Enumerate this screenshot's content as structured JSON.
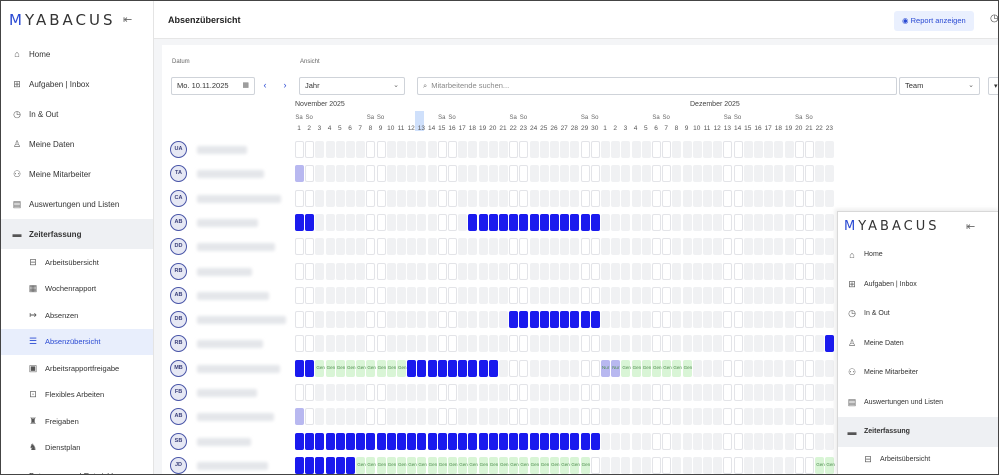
{
  "app": {
    "logo": "MYABACUS",
    "page_title": "Absenzübersicht",
    "report_button": "Report anzeigen"
  },
  "sidebar": {
    "items": [
      {
        "label": "Home",
        "icon": "home-icon",
        "type": "item"
      },
      {
        "label": "Aufgaben | Inbox",
        "icon": "inbox-icon",
        "type": "item"
      },
      {
        "label": "In & Out",
        "icon": "clock-icon",
        "type": "item"
      },
      {
        "label": "Meine Daten",
        "icon": "person-icon",
        "type": "item"
      },
      {
        "label": "Meine Mitarbeiter",
        "icon": "team-icon",
        "type": "item"
      },
      {
        "label": "Auswertungen und Listen",
        "icon": "document-icon",
        "type": "item"
      },
      {
        "label": "Zeiterfassung",
        "icon": "folder-icon",
        "type": "head"
      },
      {
        "label": "Arbeitsübersicht",
        "icon": "grid-icon",
        "type": "sub"
      },
      {
        "label": "Wochenrapport",
        "icon": "calendar-icon",
        "type": "sub"
      },
      {
        "label": "Absenzen",
        "icon": "exit-icon",
        "type": "sub"
      },
      {
        "label": "Absenzübersicht",
        "icon": "list-icon",
        "type": "sub",
        "active": true
      },
      {
        "label": "Arbeitsrapportfreigabe",
        "icon": "calendar-check-icon",
        "type": "sub"
      },
      {
        "label": "Flexibles Arbeiten",
        "icon": "desk-icon",
        "type": "sub"
      },
      {
        "label": "Freigaben",
        "icon": "approval-icon",
        "type": "sub"
      },
      {
        "label": "Dienstplan",
        "icon": "shift-icon",
        "type": "sub"
      },
      {
        "label": "Betreuung und Entwicklung",
        "icon": "folder-icon",
        "type": "item"
      }
    ]
  },
  "overlay_sidebar": {
    "items": [
      {
        "label": "Home",
        "icon": "home-icon",
        "type": "item"
      },
      {
        "label": "Aufgaben | Inbox",
        "icon": "inbox-icon",
        "type": "item"
      },
      {
        "label": "In & Out",
        "icon": "clock-icon",
        "type": "item"
      },
      {
        "label": "Meine Daten",
        "icon": "person-icon",
        "type": "item"
      },
      {
        "label": "Meine Mitarbeiter",
        "icon": "team-icon",
        "type": "item"
      },
      {
        "label": "Auswertungen und Listen",
        "icon": "document-icon",
        "type": "item"
      },
      {
        "label": "Zeiterfassung",
        "icon": "folder-icon",
        "type": "head"
      },
      {
        "label": "Arbeitsübersicht",
        "icon": "grid-icon",
        "type": "sub"
      }
    ]
  },
  "filters": {
    "date_label": "Datum",
    "date_value": "Mo. 10.11.2025",
    "view_label": "Ansicht",
    "view_value": "Jahr",
    "search_placeholder": "Mitarbeitende suchen...",
    "team_value": "Team"
  },
  "timeline": {
    "months": [
      "November 2025",
      "Dezember 2025"
    ],
    "days": [
      1,
      2,
      3,
      4,
      5,
      6,
      7,
      8,
      9,
      10,
      11,
      12,
      13,
      14,
      15,
      16,
      17,
      18,
      19,
      20,
      21,
      22,
      23,
      24,
      25,
      26,
      27,
      28,
      29,
      30,
      1,
      2,
      3,
      4,
      5,
      6,
      7,
      8,
      9,
      10,
      11,
      12,
      13,
      14,
      15,
      16,
      17,
      18,
      19,
      20,
      21,
      22,
      23
    ],
    "weekend_labels": [
      "Sa",
      "So"
    ],
    "today_day": "10. November"
  },
  "colors": {
    "absence": "#1a1aee",
    "half_absence": "#b8b8f0",
    "flex": "#d9f5d6",
    "cell": "#f0f1f3",
    "brand": "#2a4ad3"
  },
  "employees": [
    {
      "initials": "UA"
    },
    {
      "initials": "TA"
    },
    {
      "initials": "CA"
    },
    {
      "initials": "AB"
    },
    {
      "initials": "DD"
    },
    {
      "initials": "RB"
    },
    {
      "initials": "AB"
    },
    {
      "initials": "DB"
    },
    {
      "initials": "RB"
    },
    {
      "initials": "MB"
    },
    {
      "initials": "FB"
    },
    {
      "initials": "AB"
    },
    {
      "initials": "SB"
    },
    {
      "initials": "JD"
    }
  ],
  "cell_label": "Gen",
  "nur_label": "Nur"
}
